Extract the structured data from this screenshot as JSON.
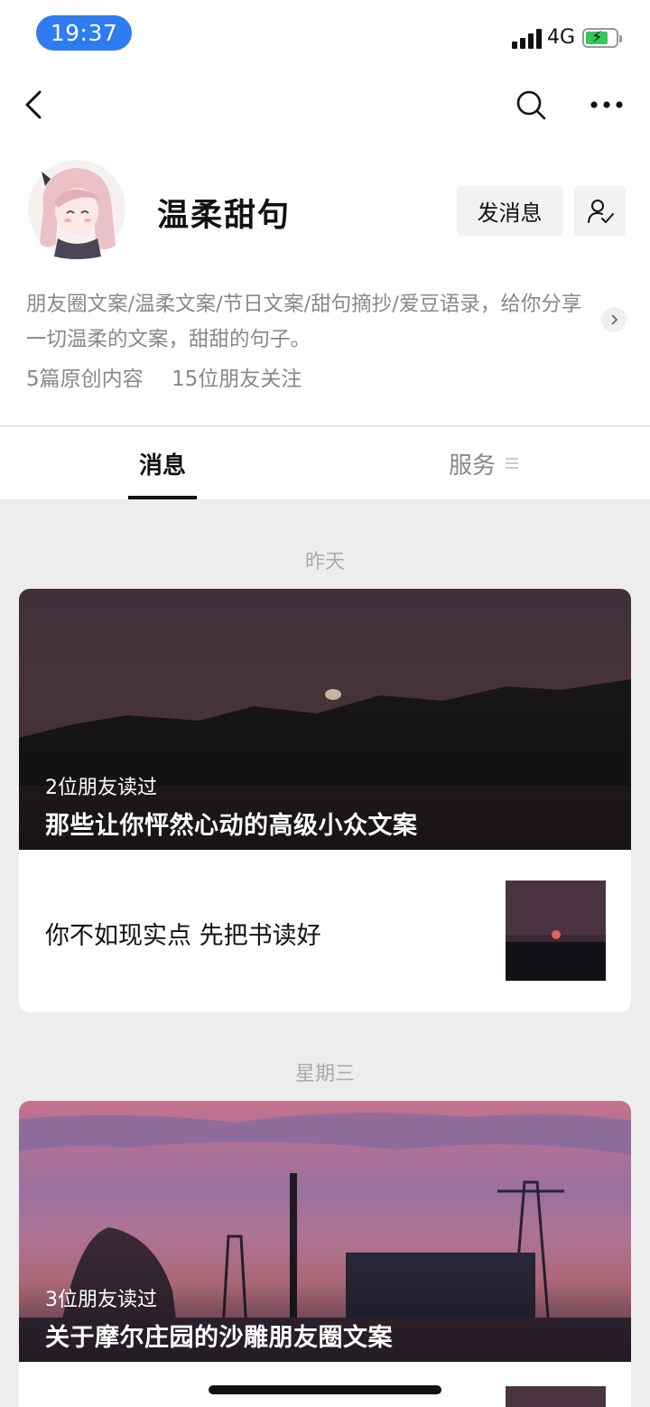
{
  "status_bar": {
    "time": "19:37",
    "network": "4G",
    "battery_level": 0.75,
    "battery_color": "#34c759",
    "time_pill_color": "#2f7bf0"
  },
  "nav": {
    "back_icon": "chevron-left-icon",
    "search_icon": "search-icon",
    "more_icon": "more-dots-icon"
  },
  "profile": {
    "name": "温柔甜句",
    "message_button": "发消息",
    "follow_icon": "user-check-icon",
    "description": "朋友圈文案/温柔文案/节日文案/甜句摘抄/爱豆语录，给你分享一切温柔的文案，甜甜的句子。",
    "original_count": "5篇原创内容",
    "friends_following": "15位朋友关注"
  },
  "tabs": {
    "messages": "消息",
    "services": "服务"
  },
  "feed": [
    {
      "date": "昨天",
      "read_count": "2位朋友读过",
      "title": "那些让你怦然心动的高级小众文案",
      "sub_article": "你不如现实点 先把书读好"
    },
    {
      "date": "星期三",
      "read_count": "3位朋友读过",
      "title": "关于摩尔庄园的沙雕朋友圈文案"
    }
  ]
}
